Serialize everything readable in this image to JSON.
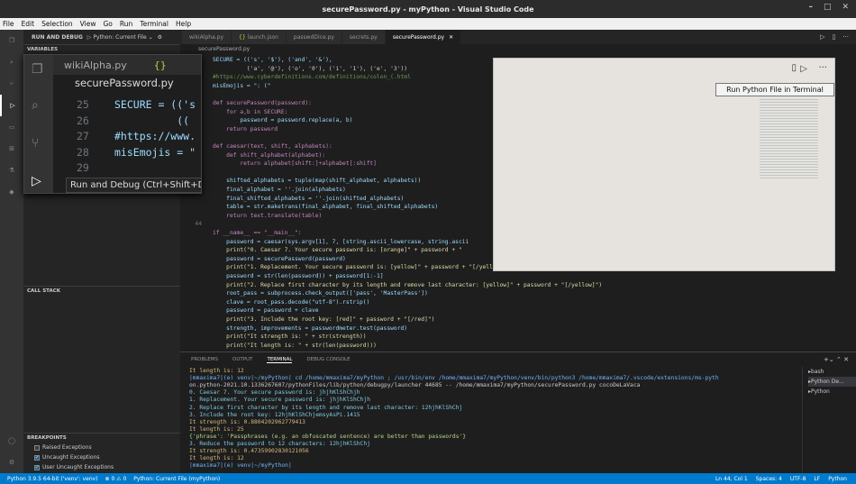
{
  "window": {
    "title": "securePassword.py - myPython - Visual Studio Code"
  },
  "menu": [
    "File",
    "Edit",
    "Selection",
    "View",
    "Go",
    "Run",
    "Terminal",
    "Help"
  ],
  "sidebar": {
    "header": "RUN AND DEBUG",
    "config": "Python: Current File",
    "variables": "VARIABLES",
    "call_stack": "CALL STACK",
    "breakpoints": "BREAKPOINTS",
    "bp_items": [
      {
        "label": "Raised Exceptions",
        "checked": false
      },
      {
        "label": "Uncaught Exceptions",
        "checked": true
      },
      {
        "label": "User Uncaught Exceptions",
        "checked": true
      }
    ]
  },
  "tabs": [
    "wikiAlpha.py",
    "launch.json",
    "passwdDice.py",
    "secrets.py",
    "securePassword.py"
  ],
  "breadcrumb": "securePassword.py",
  "editor": {
    "lines": [
      {
        "n": "",
        "t": "SECURE = (('s', '$'), ('and', '&'),"
      },
      {
        "n": "",
        "t": "          ('a', '@'), ('o', '0'), ('i', '1'), ('e', '3'))"
      },
      {
        "n": "",
        "t": "#https://www.cyberdefinitions.com/definitions/colon_(.html"
      },
      {
        "n": "",
        "t": "misEmojis = \": (\""
      },
      {
        "n": "",
        "t": ""
      },
      {
        "n": "",
        "t": "def securePassword(password):"
      },
      {
        "n": "",
        "t": "    for a,b in SECURE:"
      },
      {
        "n": "",
        "t": "        password = password.replace(a, b)"
      },
      {
        "n": "",
        "t": "    return password"
      },
      {
        "n": "",
        "t": ""
      },
      {
        "n": "",
        "t": "def caesar(text, shift, alphabets):"
      },
      {
        "n": "",
        "t": "    def shift_alphabet(alphabet):"
      },
      {
        "n": "",
        "t": "        return alphabet[shift:]+alphabet[:shift]"
      },
      {
        "n": "",
        "t": ""
      },
      {
        "n": "",
        "t": "    shifted_alphabets = tuple(map(shift_alphabet, alphabets))"
      },
      {
        "n": "",
        "t": "    final_alphabet = ''.join(alphabets)"
      },
      {
        "n": "",
        "t": "    final_shifted_alphabets = ''.join(shifted_alphabets)"
      },
      {
        "n": "",
        "t": "    table = str.maketrans(final_alphabet, final_shifted_alphabets)"
      },
      {
        "n": "",
        "t": "    return text.translate(table)"
      },
      {
        "n": "44",
        "t": ""
      },
      {
        "n": "",
        "t": "if __name__ == \"__main__\":"
      },
      {
        "n": "",
        "t": "    password = caesar(sys.argv[1], 7, [string.ascii_lowercase, string.ascii"
      },
      {
        "n": "",
        "t": "    print(\"0. Caesar 7. Your secure password is: [orange]\" + password + \""
      },
      {
        "n": "",
        "t": "    password = securePassword(password)"
      },
      {
        "n": "",
        "t": "    print(\"1. Replacement. Your secure password is: [yellow]\" + password + \"[/yellow]\")"
      },
      {
        "n": "",
        "t": "    password = str(len(password)) + password[1:-1]"
      },
      {
        "n": "",
        "t": "    print(\"2. Replace first character by its length and remove last character: [yellow]\" + password + \"[/yellow]\")"
      },
      {
        "n": "",
        "t": "    root_pass = subprocess.check_output(['pass', 'MasterPass'])"
      },
      {
        "n": "",
        "t": "    clave = root_pass.decode(\"utf-8\").rstrip()"
      },
      {
        "n": "",
        "t": "    password = password + clave"
      },
      {
        "n": "",
        "t": "    print(\"3. Include the root key: [red]\" + password + \"[/red]\")"
      },
      {
        "n": "",
        "t": "    strength, improvements = passwordmeter.test(password)"
      },
      {
        "n": "",
        "t": "    print(\"It strength is: \" + str(strength))"
      },
      {
        "n": "",
        "t": "    print(\"It length is: \" + str(len(password)))"
      }
    ]
  },
  "zoom": {
    "tab1": "wikiAlpha.py",
    "crumb": "securePassword.py",
    "lines": [
      {
        "n": "25",
        "t": "SECURE = (('s"
      },
      {
        "n": "26",
        "t": "          (("
      },
      {
        "n": "27",
        "t": "#https://www."
      },
      {
        "n": "28",
        "t": "misEmojis = \""
      },
      {
        "n": "29",
        "t": ""
      }
    ],
    "tooltip": "Run and Debug (Ctrl+Shift+D)"
  },
  "tooltip": "Run Python File in Terminal",
  "panel": {
    "tabs": [
      "PROBLEMS",
      "OUTPUT",
      "TERMINAL",
      "DEBUG CONSOLE"
    ],
    "terminal": [
      "It length is: 12",
      "|mmaxima7|(e) venv|~/myPython| cd /home/mmaxima7/myPython ; /usr/bin/env /home/mmaxima7/myPython/venv/bin/python3 /home/mmaxima7/.vscode/extensions/ms-pyth",
      "on.python-2021.10.1336267607/pythonFiles/lib/python/debugpy/launcher 44685 -- /home/mmaxima7/myPython/securePassword.py cocoDeLaVaca",
      "0. Caesar 7. Your secure password is: jhjhKlShChjh",
      "1. Replacement. Your secure password is: jhjhKlShChjh",
      "2. Replace first character by its length and remove last character: 12hjhKlShChj",
      "3. Include the root key: 12hjhKlShChjemsyAsPi.1415",
      "It strength is: 0.8804202962779413",
      "It length is: 25",
      "{'phrase': 'Passphrases (e.g. an obfuscated sentence) are better than passwords'}",
      "3. Reduce the password to 12 characters: 12hjhKlShChj",
      "It strength is: 0.47359902830121056",
      "It length is: 12",
      "|mmaxima7|(e) venv|~/myPython| "
    ],
    "shells": [
      "bash",
      "Python De...",
      "Python"
    ]
  },
  "status": {
    "left": [
      "Python 3.9.5 64-bit ('venv': venv)",
      "⊗ 0 ⚠ 0",
      "Python: Current File (myPython)"
    ],
    "right": [
      "Ln 44, Col 1",
      "Spaces: 4",
      "UTF-8",
      "LF",
      "Python"
    ]
  }
}
